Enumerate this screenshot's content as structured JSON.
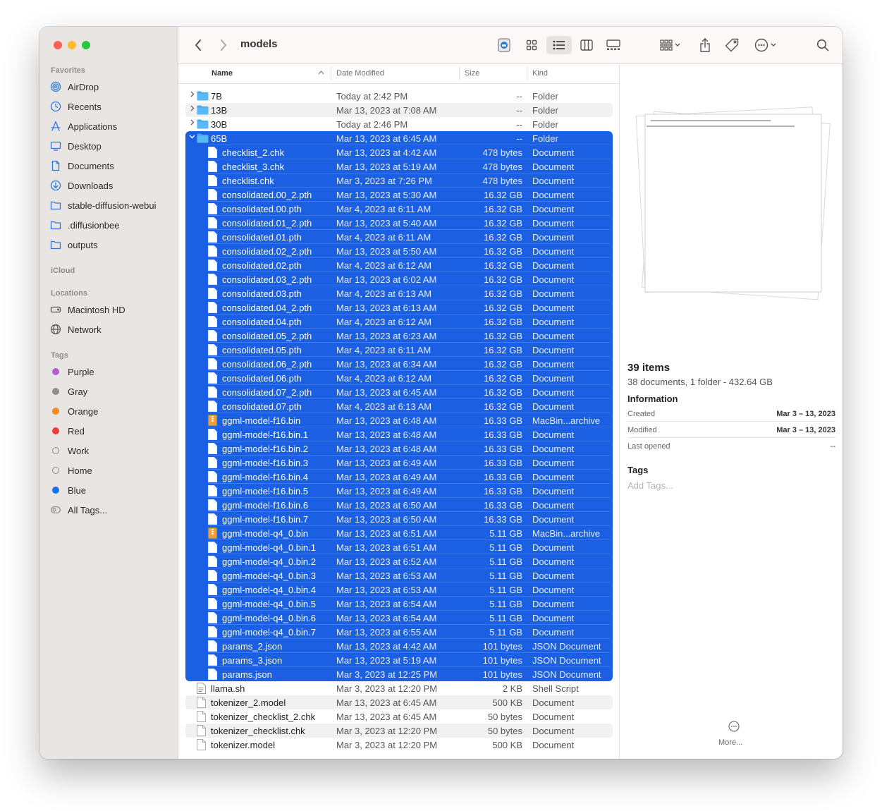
{
  "window": {
    "title": "models"
  },
  "sidebar": {
    "favorites_label": "Favorites",
    "favorites": [
      {
        "label": "AirDrop",
        "icon": "airdrop-icon"
      },
      {
        "label": "Recents",
        "icon": "clock-icon"
      },
      {
        "label": "Applications",
        "icon": "applications-icon"
      },
      {
        "label": "Desktop",
        "icon": "desktop-icon"
      },
      {
        "label": "Documents",
        "icon": "document-icon"
      },
      {
        "label": "Downloads",
        "icon": "download-icon"
      },
      {
        "label": "stable-diffusion-webui",
        "icon": "folder-icon"
      },
      {
        "label": ".diffusionbee",
        "icon": "folder-icon"
      },
      {
        "label": "outputs",
        "icon": "folder-icon"
      }
    ],
    "icloud_label": "iCloud",
    "locations_label": "Locations",
    "locations": [
      {
        "label": "Macintosh HD",
        "icon": "disk-icon"
      },
      {
        "label": "Network",
        "icon": "globe-icon"
      }
    ],
    "tags_label": "Tags",
    "tags": [
      {
        "label": "Purple",
        "color": "#b05ed1"
      },
      {
        "label": "Gray",
        "color": "#8e8e93"
      },
      {
        "label": "Orange",
        "color": "#f28c1e"
      },
      {
        "label": "Red",
        "color": "#ee3e3a"
      },
      {
        "label": "Work",
        "color": ""
      },
      {
        "label": "Home",
        "color": ""
      },
      {
        "label": "Blue",
        "color": "#1a73e8"
      },
      {
        "label": "All Tags...",
        "color": ""
      }
    ]
  },
  "columns": {
    "name": "Name",
    "date": "Date Modified",
    "size": "Size",
    "kind": "Kind"
  },
  "files": [
    {
      "name": "7B",
      "date": "Today at 2:42 PM",
      "size": "--",
      "kind": "Folder",
      "type": "folder",
      "level": 0,
      "selected": false,
      "disclosure": "collapsed"
    },
    {
      "name": "13B",
      "date": "Mar 13, 2023 at 7:08 AM",
      "size": "--",
      "kind": "Folder",
      "type": "folder",
      "level": 0,
      "selected": false,
      "disclosure": "collapsed"
    },
    {
      "name": "30B",
      "date": "Today at 2:46 PM",
      "size": "--",
      "kind": "Folder",
      "type": "folder",
      "level": 0,
      "selected": false,
      "disclosure": "collapsed"
    },
    {
      "name": "65B",
      "date": "Mar 13, 2023 at 6:45 AM",
      "size": "--",
      "kind": "Folder",
      "type": "folder",
      "level": 0,
      "selected": true,
      "disclosure": "expanded"
    },
    {
      "name": "checklist_2.chk",
      "date": "Mar 13, 2023 at 4:42 AM",
      "size": "478 bytes",
      "kind": "Document",
      "type": "doc",
      "level": 1,
      "selected": true
    },
    {
      "name": "checklist_3.chk",
      "date": "Mar 13, 2023 at 5:19 AM",
      "size": "478 bytes",
      "kind": "Document",
      "type": "doc",
      "level": 1,
      "selected": true
    },
    {
      "name": "checklist.chk",
      "date": "Mar 3, 2023 at 7:26 PM",
      "size": "478 bytes",
      "kind": "Document",
      "type": "doc",
      "level": 1,
      "selected": true
    },
    {
      "name": "consolidated.00_2.pth",
      "date": "Mar 13, 2023 at 5:30 AM",
      "size": "16.32 GB",
      "kind": "Document",
      "type": "doc",
      "level": 1,
      "selected": true
    },
    {
      "name": "consolidated.00.pth",
      "date": "Mar 4, 2023 at 6:11 AM",
      "size": "16.32 GB",
      "kind": "Document",
      "type": "doc",
      "level": 1,
      "selected": true
    },
    {
      "name": "consolidated.01_2.pth",
      "date": "Mar 13, 2023 at 5:40 AM",
      "size": "16.32 GB",
      "kind": "Document",
      "type": "doc",
      "level": 1,
      "selected": true
    },
    {
      "name": "consolidated.01.pth",
      "date": "Mar 4, 2023 at 6:11 AM",
      "size": "16.32 GB",
      "kind": "Document",
      "type": "doc",
      "level": 1,
      "selected": true
    },
    {
      "name": "consolidated.02_2.pth",
      "date": "Mar 13, 2023 at 5:50 AM",
      "size": "16.32 GB",
      "kind": "Document",
      "type": "doc",
      "level": 1,
      "selected": true
    },
    {
      "name": "consolidated.02.pth",
      "date": "Mar 4, 2023 at 6:12 AM",
      "size": "16.32 GB",
      "kind": "Document",
      "type": "doc",
      "level": 1,
      "selected": true
    },
    {
      "name": "consolidated.03_2.pth",
      "date": "Mar 13, 2023 at 6:02 AM",
      "size": "16.32 GB",
      "kind": "Document",
      "type": "doc",
      "level": 1,
      "selected": true
    },
    {
      "name": "consolidated.03.pth",
      "date": "Mar 4, 2023 at 6:13 AM",
      "size": "16.32 GB",
      "kind": "Document",
      "type": "doc",
      "level": 1,
      "selected": true
    },
    {
      "name": "consolidated.04_2.pth",
      "date": "Mar 13, 2023 at 6:13 AM",
      "size": "16.32 GB",
      "kind": "Document",
      "type": "doc",
      "level": 1,
      "selected": true
    },
    {
      "name": "consolidated.04.pth",
      "date": "Mar 4, 2023 at 6:12 AM",
      "size": "16.32 GB",
      "kind": "Document",
      "type": "doc",
      "level": 1,
      "selected": true
    },
    {
      "name": "consolidated.05_2.pth",
      "date": "Mar 13, 2023 at 6:23 AM",
      "size": "16.32 GB",
      "kind": "Document",
      "type": "doc",
      "level": 1,
      "selected": true
    },
    {
      "name": "consolidated.05.pth",
      "date": "Mar 4, 2023 at 6:11 AM",
      "size": "16.32 GB",
      "kind": "Document",
      "type": "doc",
      "level": 1,
      "selected": true
    },
    {
      "name": "consolidated.06_2.pth",
      "date": "Mar 13, 2023 at 6:34 AM",
      "size": "16.32 GB",
      "kind": "Document",
      "type": "doc",
      "level": 1,
      "selected": true
    },
    {
      "name": "consolidated.06.pth",
      "date": "Mar 4, 2023 at 6:12 AM",
      "size": "16.32 GB",
      "kind": "Document",
      "type": "doc",
      "level": 1,
      "selected": true
    },
    {
      "name": "consolidated.07_2.pth",
      "date": "Mar 13, 2023 at 6:45 AM",
      "size": "16.32 GB",
      "kind": "Document",
      "type": "doc",
      "level": 1,
      "selected": true
    },
    {
      "name": "consolidated.07.pth",
      "date": "Mar 4, 2023 at 6:13 AM",
      "size": "16.32 GB",
      "kind": "Document",
      "type": "doc",
      "level": 1,
      "selected": true
    },
    {
      "name": "ggml-model-f16.bin",
      "date": "Mar 13, 2023 at 6:48 AM",
      "size": "16.33 GB",
      "kind": "MacBin...archive",
      "type": "archive",
      "level": 1,
      "selected": true
    },
    {
      "name": "ggml-model-f16.bin.1",
      "date": "Mar 13, 2023 at 6:48 AM",
      "size": "16.33 GB",
      "kind": "Document",
      "type": "doc",
      "level": 1,
      "selected": true
    },
    {
      "name": "ggml-model-f16.bin.2",
      "date": "Mar 13, 2023 at 6:48 AM",
      "size": "16.33 GB",
      "kind": "Document",
      "type": "doc",
      "level": 1,
      "selected": true
    },
    {
      "name": "ggml-model-f16.bin.3",
      "date": "Mar 13, 2023 at 6:49 AM",
      "size": "16.33 GB",
      "kind": "Document",
      "type": "doc",
      "level": 1,
      "selected": true
    },
    {
      "name": "ggml-model-f16.bin.4",
      "date": "Mar 13, 2023 at 6:49 AM",
      "size": "16.33 GB",
      "kind": "Document",
      "type": "doc",
      "level": 1,
      "selected": true
    },
    {
      "name": "ggml-model-f16.bin.5",
      "date": "Mar 13, 2023 at 6:49 AM",
      "size": "16.33 GB",
      "kind": "Document",
      "type": "doc",
      "level": 1,
      "selected": true
    },
    {
      "name": "ggml-model-f16.bin.6",
      "date": "Mar 13, 2023 at 6:50 AM",
      "size": "16.33 GB",
      "kind": "Document",
      "type": "doc",
      "level": 1,
      "selected": true
    },
    {
      "name": "ggml-model-f16.bin.7",
      "date": "Mar 13, 2023 at 6:50 AM",
      "size": "16.33 GB",
      "kind": "Document",
      "type": "doc",
      "level": 1,
      "selected": true
    },
    {
      "name": "ggml-model-q4_0.bin",
      "date": "Mar 13, 2023 at 6:51 AM",
      "size": "5.11 GB",
      "kind": "MacBin...archive",
      "type": "archive",
      "level": 1,
      "selected": true
    },
    {
      "name": "ggml-model-q4_0.bin.1",
      "date": "Mar 13, 2023 at 6:51 AM",
      "size": "5.11 GB",
      "kind": "Document",
      "type": "doc",
      "level": 1,
      "selected": true
    },
    {
      "name": "ggml-model-q4_0.bin.2",
      "date": "Mar 13, 2023 at 6:52 AM",
      "size": "5.11 GB",
      "kind": "Document",
      "type": "doc",
      "level": 1,
      "selected": true
    },
    {
      "name": "ggml-model-q4_0.bin.3",
      "date": "Mar 13, 2023 at 6:53 AM",
      "size": "5.11 GB",
      "kind": "Document",
      "type": "doc",
      "level": 1,
      "selected": true
    },
    {
      "name": "ggml-model-q4_0.bin.4",
      "date": "Mar 13, 2023 at 6:53 AM",
      "size": "5.11 GB",
      "kind": "Document",
      "type": "doc",
      "level": 1,
      "selected": true
    },
    {
      "name": "ggml-model-q4_0.bin.5",
      "date": "Mar 13, 2023 at 6:54 AM",
      "size": "5.11 GB",
      "kind": "Document",
      "type": "doc",
      "level": 1,
      "selected": true
    },
    {
      "name": "ggml-model-q4_0.bin.6",
      "date": "Mar 13, 2023 at 6:54 AM",
      "size": "5.11 GB",
      "kind": "Document",
      "type": "doc",
      "level": 1,
      "selected": true
    },
    {
      "name": "ggml-model-q4_0.bin.7",
      "date": "Mar 13, 2023 at 6:55 AM",
      "size": "5.11 GB",
      "kind": "Document",
      "type": "doc",
      "level": 1,
      "selected": true
    },
    {
      "name": "params_2.json",
      "date": "Mar 13, 2023 at 4:42 AM",
      "size": "101 bytes",
      "kind": "JSON Document",
      "type": "doc",
      "level": 1,
      "selected": true
    },
    {
      "name": "params_3.json",
      "date": "Mar 13, 2023 at 5:19 AM",
      "size": "101 bytes",
      "kind": "JSON Document",
      "type": "doc",
      "level": 1,
      "selected": true
    },
    {
      "name": "params.json",
      "date": "Mar 3, 2023 at 12:25 PM",
      "size": "101 bytes",
      "kind": "JSON Document",
      "type": "doc",
      "level": 1,
      "selected": true
    },
    {
      "name": "llama.sh",
      "date": "Mar 3, 2023 at 12:20 PM",
      "size": "2 KB",
      "kind": "Shell Script",
      "type": "script",
      "level": 0,
      "selected": false
    },
    {
      "name": "tokenizer_2.model",
      "date": "Mar 13, 2023 at 6:45 AM",
      "size": "500 KB",
      "kind": "Document",
      "type": "doc",
      "level": 0,
      "selected": false
    },
    {
      "name": "tokenizer_checklist_2.chk",
      "date": "Mar 13, 2023 at 6:45 AM",
      "size": "50 bytes",
      "kind": "Document",
      "type": "doc",
      "level": 0,
      "selected": false
    },
    {
      "name": "tokenizer_checklist.chk",
      "date": "Mar 3, 2023 at 12:20 PM",
      "size": "50 bytes",
      "kind": "Document",
      "type": "doc",
      "level": 0,
      "selected": false
    },
    {
      "name": "tokenizer.model",
      "date": "Mar 3, 2023 at 12:20 PM",
      "size": "500 KB",
      "kind": "Document",
      "type": "doc",
      "level": 0,
      "selected": false
    }
  ],
  "preview": {
    "count": "39 items",
    "summary": "38 documents, 1 folder - 432.64 GB",
    "info_label": "Information",
    "created_label": "Created",
    "created": "Mar 3 – 13, 2023",
    "modified_label": "Modified",
    "modified": "Mar 3 – 13, 2023",
    "opened_label": "Last opened",
    "opened": "--",
    "tags_label": "Tags",
    "tags_placeholder": "Add Tags...",
    "more_label": "More..."
  },
  "colors": {
    "selection": "#1b5fe2",
    "folder": "#3da9f5",
    "accent": "#2f78d8"
  }
}
